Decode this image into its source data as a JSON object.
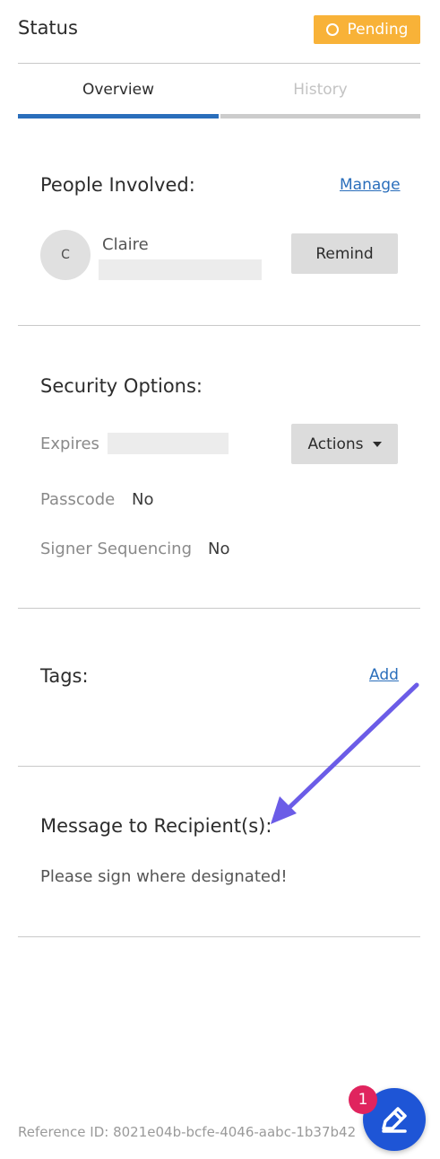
{
  "header": {
    "title": "Status",
    "status_badge": "Pending"
  },
  "tabs": [
    {
      "label": "Overview",
      "active": true
    },
    {
      "label": "History",
      "active": false
    }
  ],
  "people": {
    "title": "People Involved:",
    "manage_link": "Manage",
    "persons": [
      {
        "initial": "C",
        "name": "Claire",
        "action": "Remind"
      }
    ]
  },
  "security": {
    "title": "Security Options:",
    "actions_button": "Actions",
    "rows": [
      {
        "label": "Expires",
        "value": ""
      },
      {
        "label": "Passcode",
        "value": "No"
      },
      {
        "label": "Signer Sequencing",
        "value": "No"
      }
    ]
  },
  "tags": {
    "title": "Tags:",
    "add_link": "Add"
  },
  "message": {
    "title": "Message to Recipient(s):",
    "text": "Please sign where designated!"
  },
  "footer": {
    "reference": "Reference ID: 8021e04b-bcfe-4046-aabc-1b37b42"
  },
  "help": {
    "badge_count": "1",
    "icon": "edit-pencil-icon"
  },
  "colors": {
    "accent": "#2a6ebb",
    "pending": "#f8b238",
    "arrow": "#6b5ce7",
    "fab": "#1e55d6",
    "badge": "#e0245e"
  }
}
